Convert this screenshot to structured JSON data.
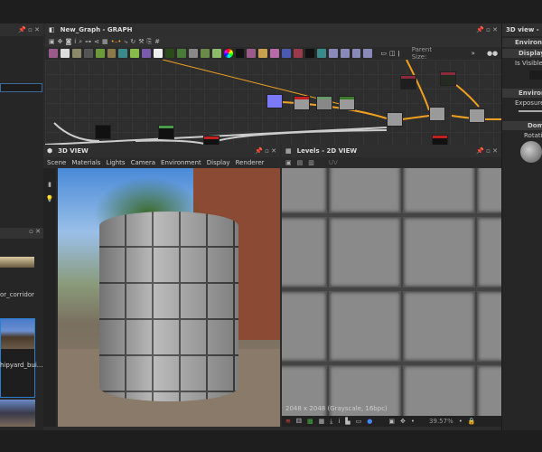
{
  "graph": {
    "title": "New_Graph - GRAPH",
    "parent_size_label": "Parent Size:"
  },
  "view3d": {
    "title": "3D VIEW",
    "menu": [
      "Scene",
      "Materials",
      "Lights",
      "Camera",
      "Environment",
      "Display",
      "Renderer"
    ]
  },
  "view2d": {
    "title": "Levels - 2D VIEW",
    "uv_label": "UV",
    "info": "2048 x 2048 (Grayscale, 16bpc)",
    "zoom": "39.57%"
  },
  "right": {
    "title": "3D view -",
    "sections": [
      "Environment",
      "Display",
      "Is Visible",
      "Environment",
      "Exposure",
      "Dome",
      "Rotation"
    ]
  },
  "left": {
    "items": [
      "or_corridor",
      "hipyard_bui..."
    ]
  },
  "colors": {
    "accent": "#f0a020",
    "selection": "#2a7fd0"
  }
}
